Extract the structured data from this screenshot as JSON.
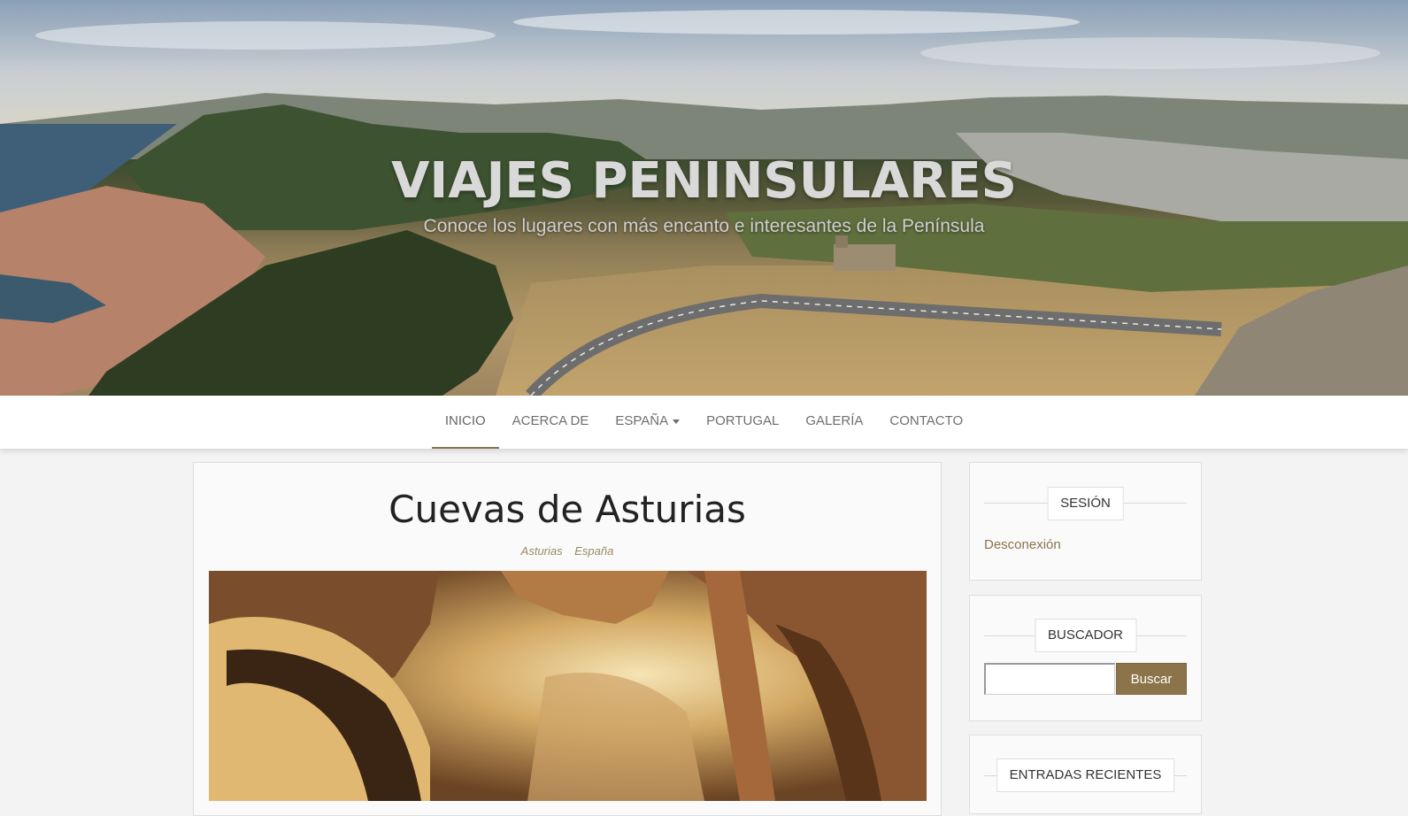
{
  "site": {
    "title": "VIAJES PENINSULARES",
    "tagline": "Conoce los lugares con más encanto e interesantes de la Península"
  },
  "nav": {
    "items": [
      {
        "label": "INICIO",
        "active": true
      },
      {
        "label": "ACERCA DE"
      },
      {
        "label": "ESPAÑA",
        "dropdown": true
      },
      {
        "label": "PORTUGAL"
      },
      {
        "label": "GALERÍA"
      },
      {
        "label": "CONTACTO"
      }
    ]
  },
  "post": {
    "title": "Cuevas de Asturias",
    "categories": [
      "Asturias",
      "España"
    ]
  },
  "sidebar": {
    "session": {
      "title": "SESIÓN",
      "link": "Desconexión"
    },
    "search": {
      "title": "BUSCADOR",
      "button": "Buscar",
      "value": ""
    },
    "recent": {
      "title": "ENTRADAS RECIENTES"
    }
  },
  "colors": {
    "accent": "#8b7449",
    "nav_text": "#6e6e6e",
    "background": "#f3f3f3"
  }
}
